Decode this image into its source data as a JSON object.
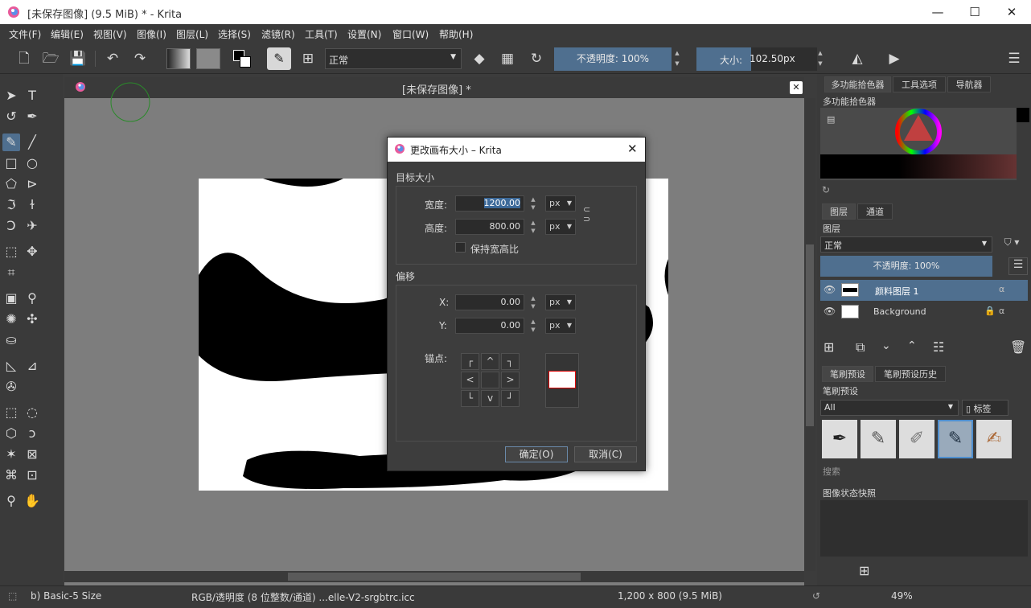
{
  "window": {
    "title": "[未保存图像] (9.5 MiB) * - Krita",
    "minimize": "—",
    "maximize": "☐",
    "close": "✕"
  },
  "menu": [
    "文件(F)",
    "编辑(E)",
    "视图(V)",
    "图像(I)",
    "图层(L)",
    "选择(S)",
    "滤镜(R)",
    "工具(T)",
    "设置(N)",
    "窗口(W)",
    "帮助(H)"
  ],
  "toolbar": {
    "blend_mode": "正常",
    "opacity_label": "不透明度: 100%",
    "size_label": "大小:",
    "size_value": "102.50px"
  },
  "document": {
    "tab_title": "[未保存图像] *"
  },
  "dialog": {
    "title": "更改画布大小 – Krita",
    "target_size_heading": "目标大小",
    "width_label": "宽度:",
    "width_value": "1200.00",
    "height_label": "高度:",
    "height_value": "800.00",
    "unit": "px",
    "keep_ratio_label": "保持宽高比",
    "offset_heading": "偏移",
    "x_label": "X:",
    "x_value": "0.00",
    "y_label": "Y:",
    "y_value": "0.00",
    "anchor_label": "锚点:",
    "ok_label": "确定(O)",
    "cancel_label": "取消(C)"
  },
  "right_panel": {
    "tabs_top": [
      "多功能拾色器",
      "工具选项",
      "导航器"
    ],
    "color_selector_title": "多功能拾色器",
    "layer_tabs": [
      "图层",
      "通道"
    ],
    "layers_title": "图层",
    "layer_blend": "正常",
    "layer_opacity": "不透明度: 100%",
    "layers": [
      {
        "name": "颜料图层 1",
        "selected": true
      },
      {
        "name": "Background",
        "selected": false
      }
    ],
    "brush_tabs": [
      "笔刷预设",
      "笔刷预设历史"
    ],
    "brush_title": "笔刷预设",
    "brush_filter": "All",
    "brush_tag": "标签",
    "search_placeholder": "搜索",
    "snapshot_title": "图像状态快照"
  },
  "status": {
    "brush": "b) Basic-5 Size",
    "color_space": "RGB/透明度 (8 位整数/通道) ...elle-V2-srgbtrc.icc",
    "dimensions": "1,200 x 800 (9.5 MiB)",
    "zoom": "49%"
  },
  "colors": {
    "accent": "#4f6f8f",
    "panel": "#3a3a3a",
    "canvas_bg": "#7d7d7d"
  }
}
